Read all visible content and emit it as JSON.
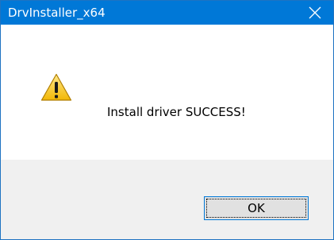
{
  "window": {
    "title": "DrvInstaller_x64",
    "close_icon": "close-icon"
  },
  "message": {
    "icon": "warning-icon",
    "text": "Install driver SUCCESS!"
  },
  "buttons": {
    "ok_label": "OK"
  },
  "colors": {
    "titlebar": "#0078d7",
    "footer": "#f0f0f0",
    "warning_fill": "#f5c518"
  }
}
